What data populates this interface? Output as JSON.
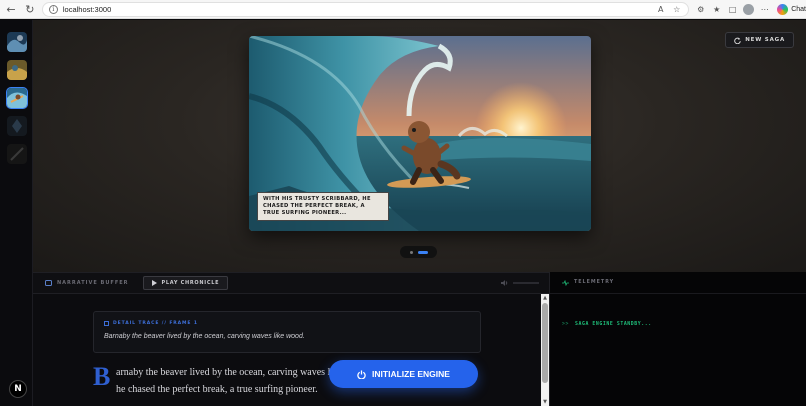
{
  "browser": {
    "url": "localhost:3000",
    "chat_label": "Chat"
  },
  "stage": {
    "new_saga_label": "NEW SAGA",
    "caption": "WITH HIS TRUSTY SCRIBBARD, HE CHASED THE PERFECT BREAK, A TRUE SURFING PIONEER...",
    "pager_total": 2,
    "pager_active": 2
  },
  "toolbar": {
    "narrative_label": "NARRATIVE BUFFER",
    "play_label": "PLAY CHRONICLE"
  },
  "reader": {
    "detail_heading": "DETAIL TRACE // FRAME 1",
    "detail_text": "Barnaby the beaver lived by the ocean, carving waves like wood.",
    "dropcap": "B",
    "line1": "arnaby the beaver lived by the ocean, carving waves li",
    "line2": "he chased the perfect break, a true surfing pioneer.",
    "init_button": "INITIALIZE ENGINE"
  },
  "telemetry": {
    "title": "TELEMETRY",
    "prompt": ">>",
    "status": "SAGA ENGINE STANDBY..."
  },
  "colors": {
    "accent": "#2563eb",
    "telemetry_green": "#1fbf7a"
  },
  "sidebar": {
    "n_logo": "N"
  }
}
